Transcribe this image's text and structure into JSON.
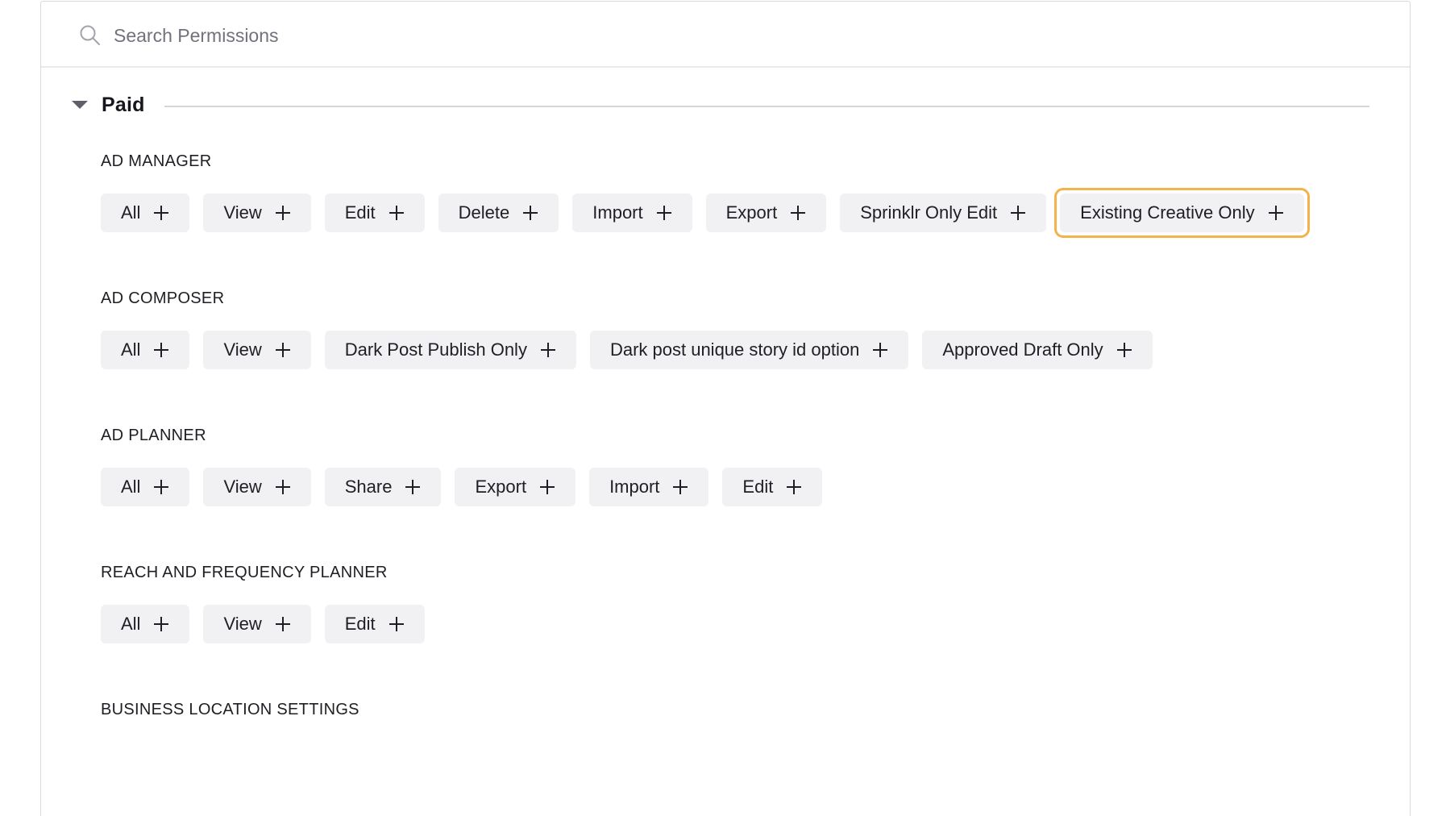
{
  "search": {
    "placeholder": "Search Permissions",
    "value": ""
  },
  "group": {
    "title": "Paid",
    "expanded": true
  },
  "focus_color": "#f2b24c",
  "sections": [
    {
      "title": "AD MANAGER",
      "chips": [
        {
          "label": "All"
        },
        {
          "label": "View"
        },
        {
          "label": "Edit"
        },
        {
          "label": "Delete"
        },
        {
          "label": "Import"
        },
        {
          "label": "Export"
        },
        {
          "label": "Sprinklr Only Edit"
        },
        {
          "label": "Existing Creative Only",
          "focused": true
        }
      ]
    },
    {
      "title": "AD COMPOSER",
      "chips": [
        {
          "label": "All"
        },
        {
          "label": "View"
        },
        {
          "label": "Dark Post Publish Only"
        },
        {
          "label": "Dark post unique story id option"
        },
        {
          "label": "Approved Draft Only"
        }
      ]
    },
    {
      "title": "AD PLANNER",
      "chips": [
        {
          "label": "All"
        },
        {
          "label": "View"
        },
        {
          "label": "Share"
        },
        {
          "label": "Export"
        },
        {
          "label": "Import"
        },
        {
          "label": "Edit"
        }
      ]
    },
    {
      "title": "REACH AND FREQUENCY PLANNER",
      "chips": [
        {
          "label": "All"
        },
        {
          "label": "View"
        },
        {
          "label": "Edit"
        }
      ]
    },
    {
      "title": "BUSINESS LOCATION SETTINGS",
      "chips": []
    }
  ]
}
